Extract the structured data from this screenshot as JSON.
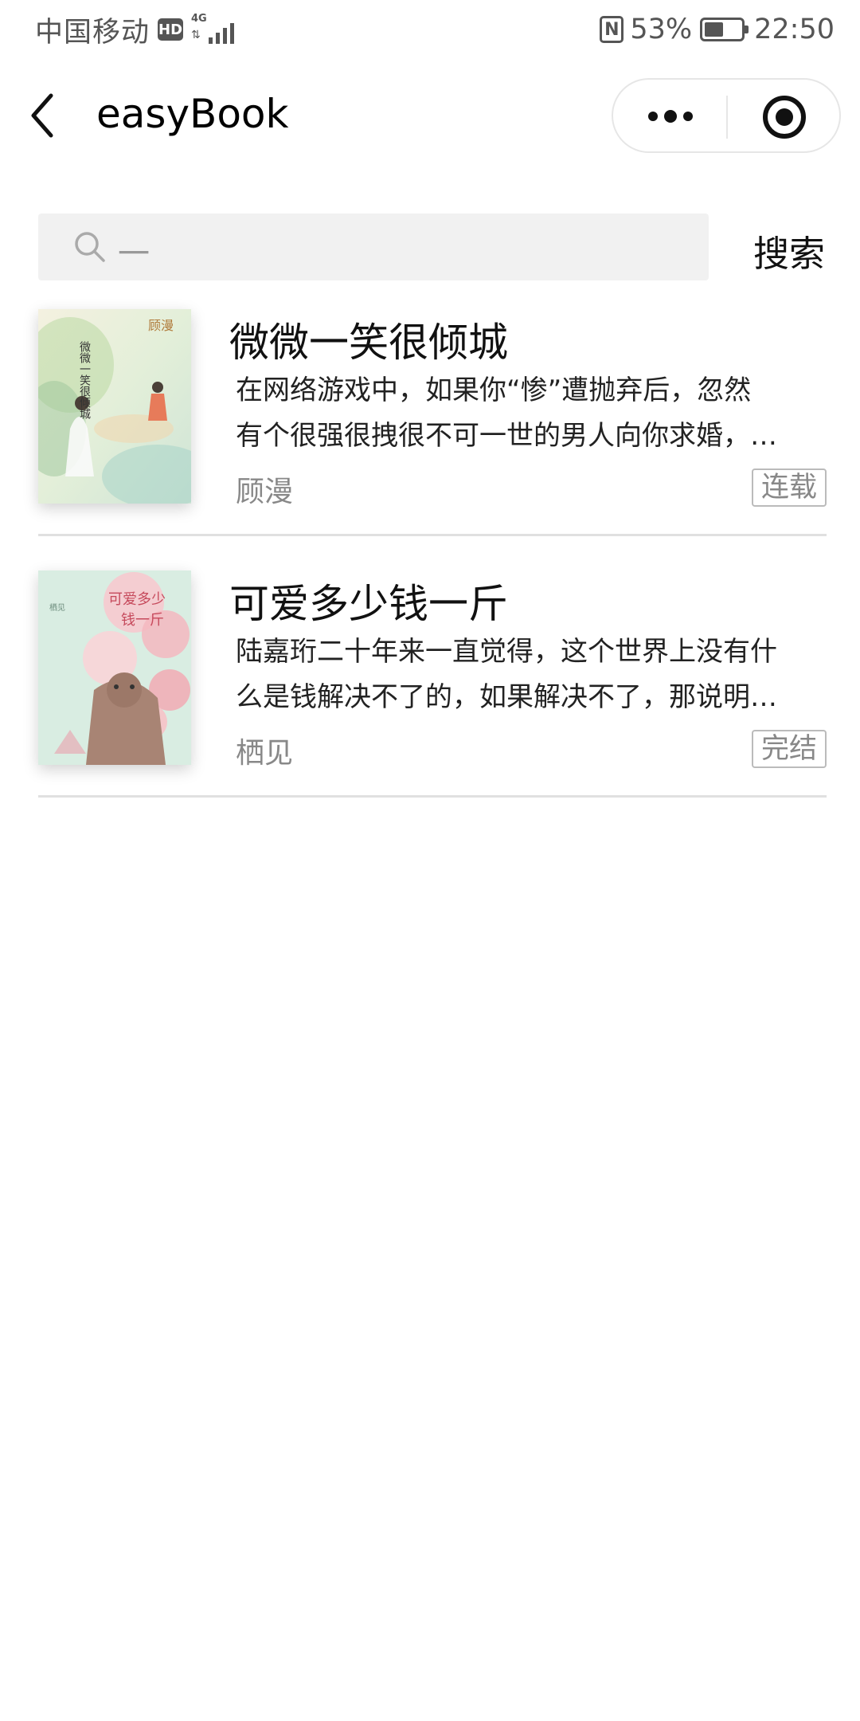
{
  "status_bar": {
    "carrier": "中国移动",
    "hd": "HD",
    "network": "4G",
    "nfc": "N",
    "battery_percent": "53%",
    "battery_level": 0.53,
    "time": "22:50"
  },
  "nav": {
    "title": "easyBook",
    "icons": [
      "back-icon",
      "more-icon",
      "close-icon"
    ]
  },
  "search": {
    "value": "一",
    "button_label": "搜索"
  },
  "books": [
    {
      "title": "微微一笑很倾城",
      "desc_line1": "在网络游戏中，如果你“惨”遭抛弃后，忽然",
      "desc_line2": "有个很强很拽很不可一世的男人向你求婚，…",
      "author": "顾漫",
      "status": "连载",
      "cover": {
        "text_a": "顾漫",
        "text_b": "微微一笑很倾城"
      }
    },
    {
      "title": "可爱多少钱一斤",
      "desc_line1": "陆嘉珩二十年来一直觉得，这个世界上没有什",
      "desc_line2": "么是钱解决不了的，如果解决不了，那说明…",
      "author": "栖见",
      "status": "完结",
      "cover": {
        "text_a": "可爱多少",
        "text_b": "钱一斤"
      }
    }
  ],
  "colors": {
    "search_bg": "#f1f1f1",
    "divider": "#e0e0e0",
    "muted_text": "#888888"
  }
}
